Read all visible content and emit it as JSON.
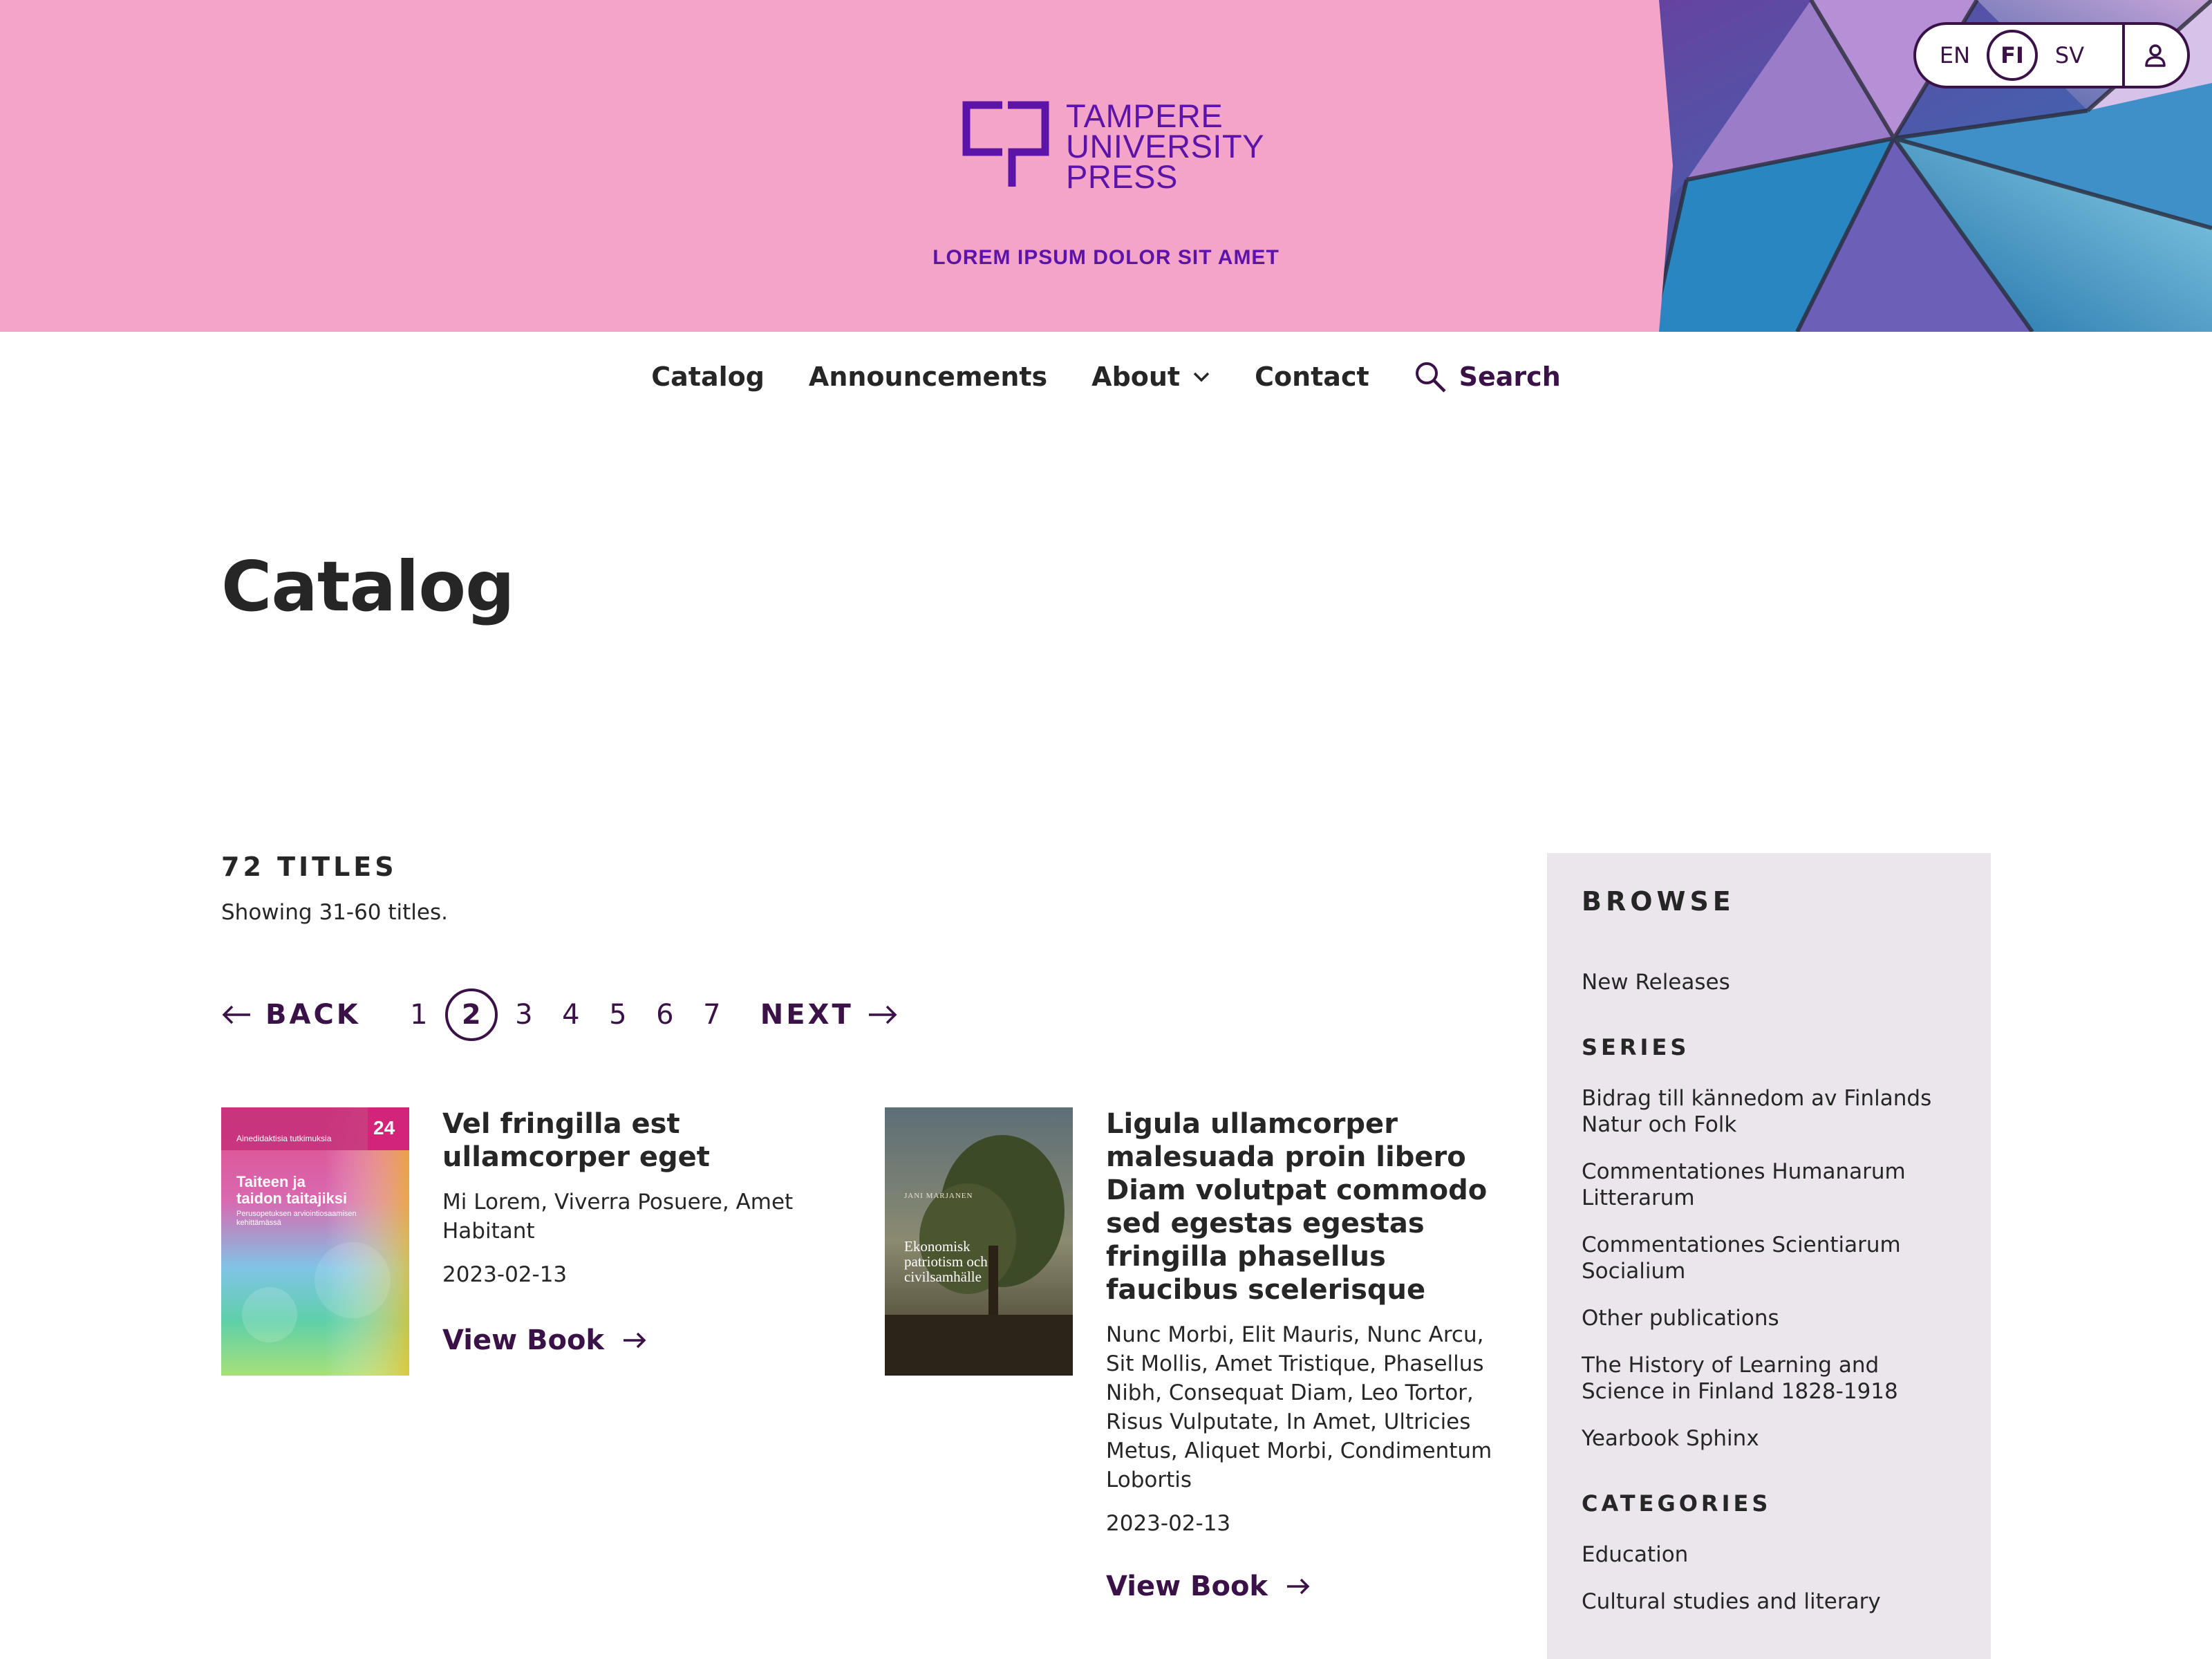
{
  "header": {
    "logo_lines": [
      "TAMPERE",
      "UNIVERSITY",
      "PRESS"
    ],
    "tagline": "LOREM IPSUM DOLOR SIT AMET",
    "languages": [
      "EN",
      "FI",
      "SV"
    ],
    "active_language": "FI",
    "colors": {
      "band": "#f4a3c9",
      "brand": "#5b13a8",
      "dark": "#3b1248"
    }
  },
  "nav": {
    "catalog": "Catalog",
    "announcements": "Announcements",
    "about": "About",
    "contact": "Contact",
    "search": "Search"
  },
  "page": {
    "title": "Catalog",
    "count": "72 TITLES",
    "showing": "Showing 31-60 titles."
  },
  "pagination": {
    "back": "BACK",
    "next": "NEXT",
    "pages": [
      "1",
      "2",
      "3",
      "4",
      "5",
      "6",
      "7"
    ],
    "current": "2"
  },
  "books": [
    {
      "title": "Vel fringilla est ullamcorper eget",
      "authors": "Mi Lorem, Viverra Posuere, Amet Habitant",
      "date": "2023-02-13",
      "link": "View Book",
      "cover": {
        "series": "Ainedidaktisia tutkimuksia",
        "number": "24",
        "title_lines": [
          "Taiteen ja",
          "taidon taitajiksi"
        ],
        "subtitle": "Perusopetuksen arviointiosaamisen kehittämässä"
      }
    },
    {
      "title": "Ligula ullamcorper malesuada proin libero Diam volutpat commodo sed egestas egestas fringilla phasellus faucibus scelerisque",
      "authors": "Nunc Morbi, Elit Mauris, Nunc Arcu, Sit Mollis, Amet Tristique, Phasellus Nibh, Consequat Diam, Leo Tortor, Risus Vulputate, In Amet, Ultricies Metus, Aliquet Morbi, Condimentum Lobortis",
      "date": "2023-02-13",
      "link": "View Book",
      "cover": {
        "author": "JANI MARJANEN",
        "title_lines": [
          "Ekonomisk",
          "patriotism och",
          "civilsamhälle"
        ]
      }
    }
  ],
  "sidebar": {
    "heading": "BROWSE",
    "new_releases": "New Releases",
    "series_heading": "SERIES",
    "series": [
      "Bidrag till kännedom av Finlands Natur och Folk",
      "Commentationes Humanarum Litterarum",
      "Commentationes Scientiarum Socialium",
      "Other publications",
      "The History of Learning and Science in Finland 1828-1918",
      "Yearbook Sphinx"
    ],
    "categories_heading": "CATEGORIES",
    "categories": [
      "Education",
      "Cultural studies and literary"
    ]
  },
  "icons": [
    "logo-mark",
    "user-icon",
    "chevron-down-icon",
    "search-icon",
    "arrow-left-icon",
    "arrow-right-icon"
  ]
}
